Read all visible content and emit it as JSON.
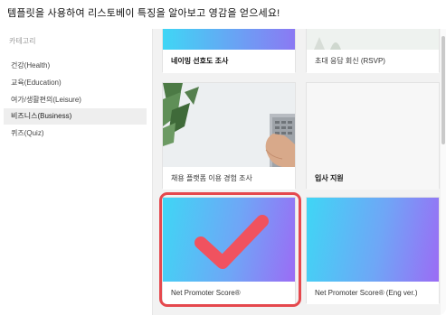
{
  "header": {
    "title": "템플릿을 사용하여 리스토베이 특징을 알아보고 영감을 얻으세요!"
  },
  "sidebar": {
    "title": "카테고리",
    "items": [
      {
        "label": "건강(Health)",
        "active": false
      },
      {
        "label": "교육(Education)",
        "active": false
      },
      {
        "label": "여가/생활편의(Leisure)",
        "active": false
      },
      {
        "label": "비즈니스(Business)",
        "active": true
      },
      {
        "label": "퀴즈(Quiz)",
        "active": false
      }
    ]
  },
  "templates": [
    {
      "label": "네이밍 선호도 조사",
      "bold": true
    },
    {
      "label": "초대 응답 회신 (RSVP)",
      "bold": false
    },
    {
      "label": "채용 플랫폼 이용 경험 조사",
      "bold": false
    },
    {
      "label": "입사 지원",
      "bold": true
    },
    {
      "label": "Net Promoter Score®",
      "bold": false
    },
    {
      "label": "Net Promoter Score® (Eng ver.)",
      "bold": false
    }
  ],
  "colors": {
    "accent_highlight": "#e5484d",
    "checkmark": "#f0525f",
    "gradient_start": "#3fd6f5",
    "gradient_end": "#9b6cf5"
  },
  "icons": {
    "checkmark": "check-icon"
  }
}
